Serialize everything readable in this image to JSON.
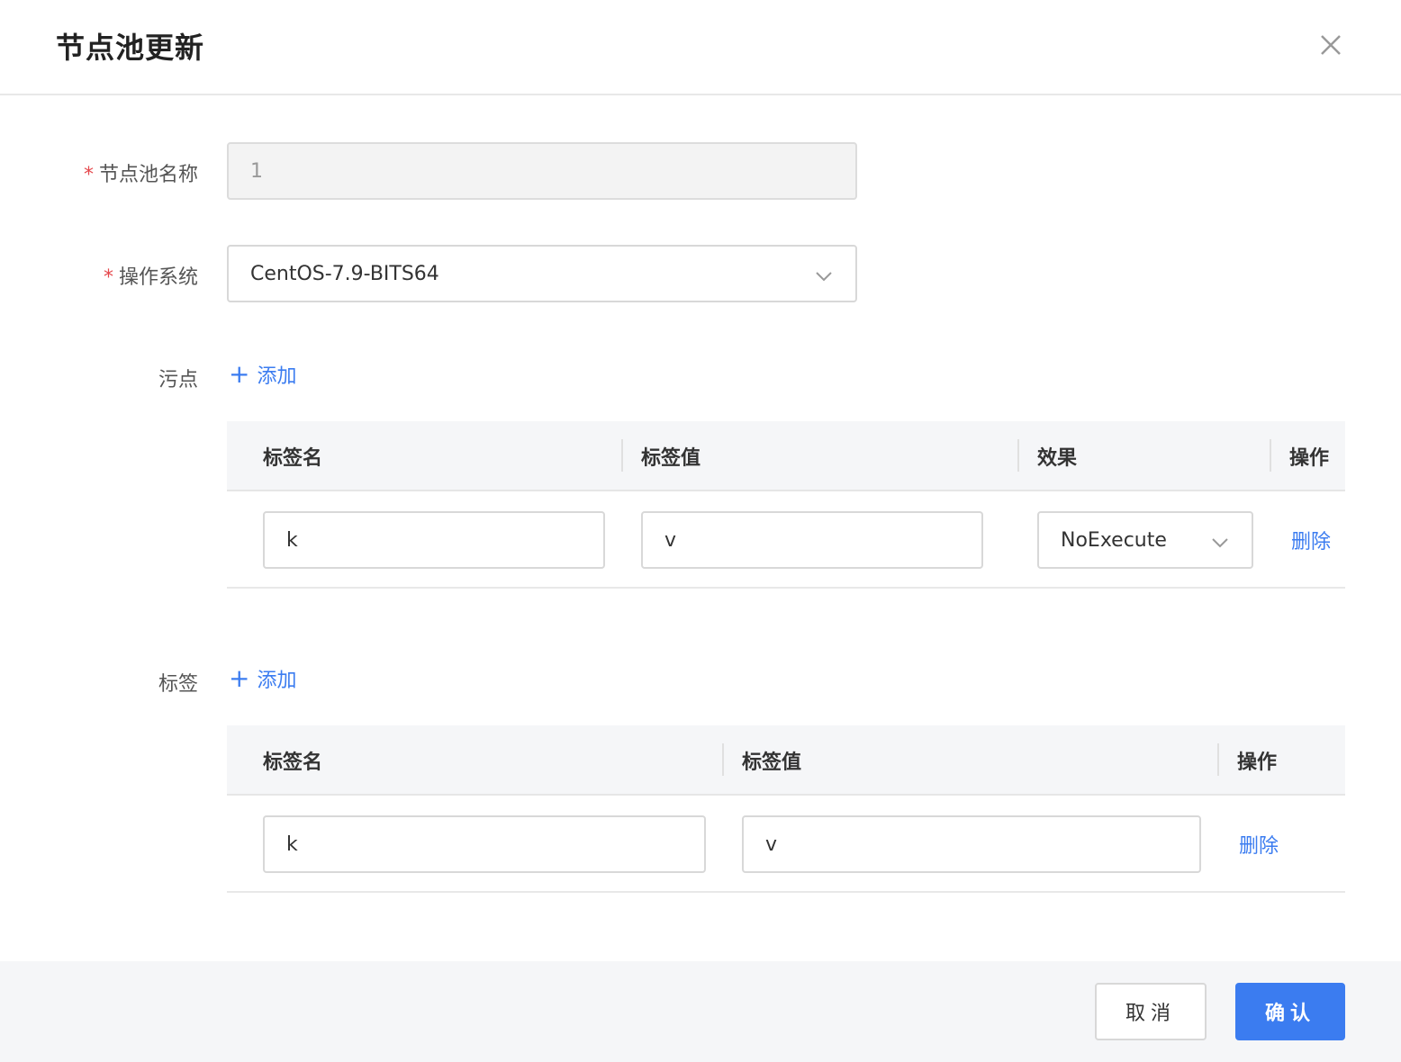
{
  "dialog": {
    "title": "节点池更新"
  },
  "form": {
    "pool_name": {
      "label": "节点池名称",
      "required": "*",
      "value": "1"
    },
    "os": {
      "label": "操作系统",
      "required": "*",
      "value": "CentOS-7.9-BITS64"
    },
    "taints": {
      "label": "污点",
      "add_label": "添加",
      "add_icon": "+",
      "columns": [
        "标签名",
        "标签值",
        "效果",
        "操作"
      ],
      "rows": [
        {
          "key": "k",
          "value": "v",
          "effect": "NoExecute",
          "action": "删除"
        }
      ]
    },
    "labels": {
      "label": "标签",
      "add_label": "添加",
      "add_icon": "+",
      "columns": [
        "标签名",
        "标签值",
        "操作"
      ],
      "rows": [
        {
          "key": "k",
          "value": "v",
          "action": "删除"
        }
      ]
    }
  },
  "footer": {
    "cancel_label": "取消",
    "ok_label": "确认"
  },
  "colors": {
    "primary": "#3b7cf0",
    "required": "#e5484d"
  }
}
